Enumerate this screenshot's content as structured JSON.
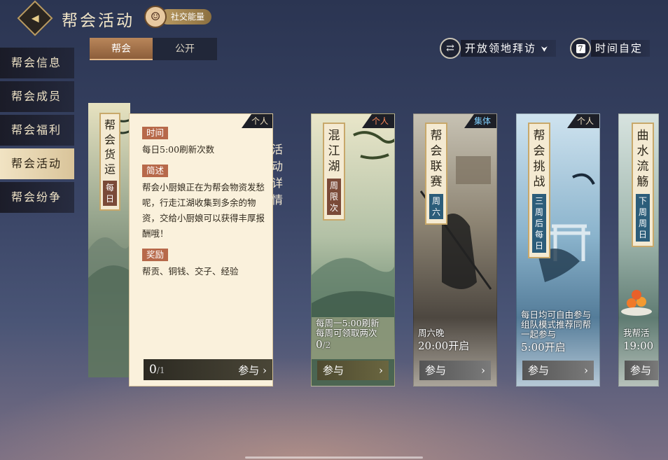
{
  "header": {
    "back_icon": "diamond-back-icon",
    "title": "帮会活动",
    "social_badge": "社交能量"
  },
  "tabs": [
    {
      "label": "帮会",
      "active": true
    },
    {
      "label": "公开",
      "active": false
    }
  ],
  "controls": {
    "visit_label": "开放领地拜访",
    "visit_arrow": "⮟",
    "time_label": "时间自定",
    "time_icon_text": "7"
  },
  "sidebar": {
    "items": [
      {
        "label": "帮会信息",
        "active": false
      },
      {
        "label": "帮会成员",
        "active": false
      },
      {
        "label": "帮会福利",
        "active": false
      },
      {
        "label": "帮会活动",
        "active": true
      },
      {
        "label": "帮会纷争",
        "active": false
      }
    ]
  },
  "expanded": {
    "title": "帮会货运",
    "freq": "每日",
    "tag": "个人",
    "time_label": "时间",
    "time_text": "每日5:00刷新次数",
    "brief_label": "简述",
    "brief_text": "帮会小厨娘正在为帮会物资发愁呢，行走江湖收集到多余的物资，交给小厨娘可以获得丰厚报酬哦！",
    "reward_label": "奖励",
    "reward_text": "帮贡、铜钱、交子、经验",
    "count": "0",
    "count_total": "/1",
    "join_label": "参与",
    "detail_tab": "活动详情"
  },
  "cards": [
    {
      "title": "混江湖",
      "freq": "周限次",
      "tag": "个人",
      "line1": "每周一5:00刷新",
      "line2": "每周可领取两次",
      "count": "0",
      "count_total": "/2",
      "join_label": "参与"
    },
    {
      "title": "帮会联赛",
      "freq": "周六",
      "tag": "集体",
      "line1": "周六晚",
      "line2": "20:00开启",
      "join_label": "参与"
    },
    {
      "title": "帮会挑战",
      "freq": "三周后每日",
      "tag": "个人",
      "line1": "每日均可自由参与",
      "line2": "组队模式推荐同帮",
      "line3": "一起参与",
      "line4": "5:00开启",
      "join_label": "参与"
    },
    {
      "title": "曲水流觞",
      "freq": "下周周日",
      "line1": "我帮活",
      "line2": "19:00",
      "join_label": "参与"
    }
  ]
}
